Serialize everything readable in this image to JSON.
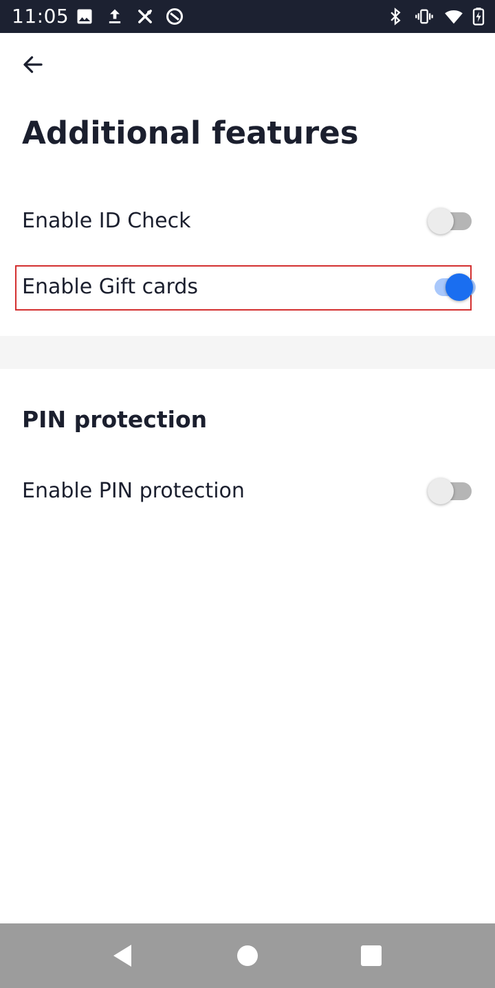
{
  "status_bar": {
    "time": "11:05",
    "left_icons": [
      "image-icon",
      "upload-icon",
      "crossed-tools-icon",
      "data-saver-icon"
    ],
    "right_icons": [
      "bluetooth-icon",
      "vibrate-icon",
      "wifi-icon",
      "battery-charging-icon"
    ]
  },
  "app_bar": {
    "back_icon": "arrow-left-icon"
  },
  "page": {
    "title": "Additional features",
    "settings": [
      {
        "label": "Enable ID Check",
        "enabled": false
      },
      {
        "label": "Enable Gift cards",
        "enabled": true,
        "highlighted": true
      }
    ],
    "pin_section": {
      "heading": "PIN protection",
      "settings": [
        {
          "label": "Enable PIN protection",
          "enabled": false
        }
      ]
    }
  },
  "colors": {
    "status_bar_bg": "#1c2131",
    "text": "#1b1f2e",
    "toggle_on": "#1a6ef0",
    "toggle_on_track": "#a9c8fb",
    "toggle_off_thumb": "#ececec",
    "toggle_off_track": "#b5b5b5",
    "highlight": "#d32f2f",
    "divider_bg": "#f5f5f5",
    "nav_bar_bg": "#9c9c9c"
  },
  "nav_bar": {
    "buttons": [
      "back-triangle-icon",
      "home-circle-icon",
      "recents-square-icon"
    ]
  }
}
